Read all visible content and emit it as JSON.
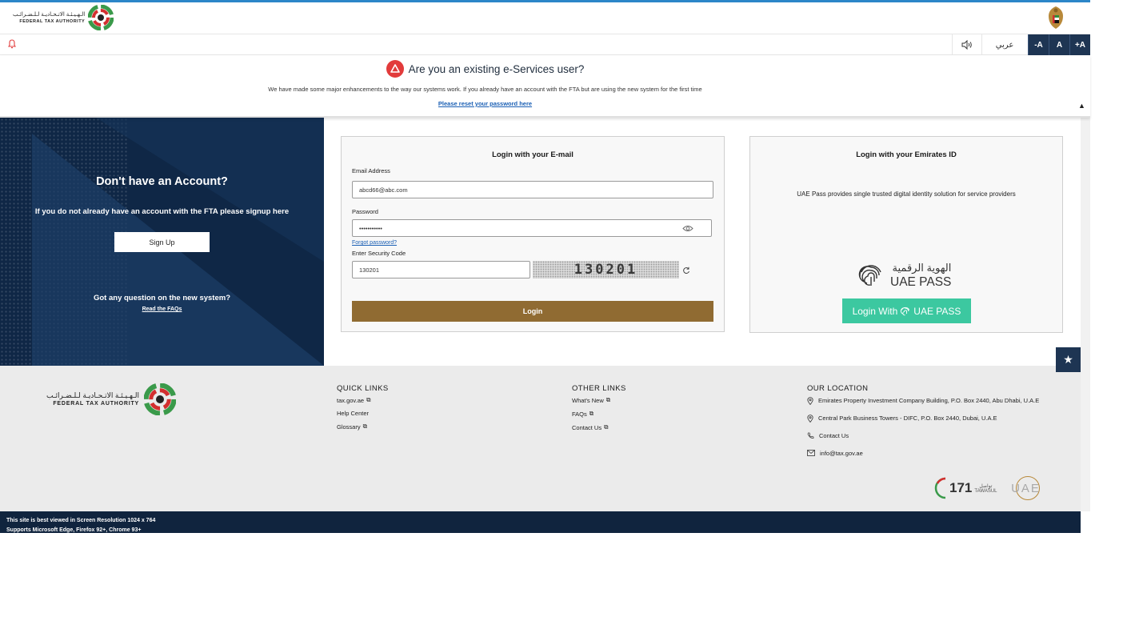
{
  "header": {
    "logo_ar": "الـهـيـئـة الاتـحـاديـة لـلـضـرائـب",
    "logo_en": "FEDERAL TAX AUTHORITY",
    "language_label": "عربي",
    "font_decrease": "-A",
    "font_reset": "A",
    "font_increase": "+A"
  },
  "notice": {
    "title": "Are you an existing e-Services user?",
    "text": "We have made some major enhancements to the way our systems work. If you already have an account with the FTA but are using the new system for the first time",
    "link": "Please reset your password here"
  },
  "promo": {
    "heading": "Don't have an Account?",
    "text": "If you do not already have an account with the FTA please signup here",
    "signup_label": "Sign Up",
    "question": "Got any question on the new system?",
    "faq_link": "Read the FAQs"
  },
  "email_login": {
    "title": "Login with your E-mail",
    "email_label": "Email Address",
    "email_value": "abcd66@abc.com",
    "password_label": "Password",
    "password_value": "•••••••••••",
    "forgot_link": "Forgot password?",
    "security_label": "Enter Security Code",
    "security_value": "130201",
    "captcha_text": "130201",
    "login_label": "Login"
  },
  "eid_login": {
    "title": "Login with your Emirates ID",
    "text": "UAE Pass provides single trusted digital identity solution for service providers",
    "logo_ar": "الهوية الرقمية",
    "logo_en": "UAE PASS",
    "button_prefix": "Login With",
    "button_brand": "UAE PASS"
  },
  "footer": {
    "logo_ar": "الـهـيـئـة الاتـحـاديـة لـلـضـرائـب",
    "logo_en": "FEDERAL TAX AUTHORITY",
    "quick_links": {
      "title": "QUICK LINKS",
      "items": [
        "tax.gov.ae",
        "Help Center",
        "Glossary"
      ]
    },
    "other_links": {
      "title": "OTHER LINKS",
      "items": [
        "What's New",
        "FAQs",
        "Contact Us"
      ]
    },
    "location": {
      "title": "OUR LOCATION",
      "address1": "Emirates Property Investment Company Building, P.O. Box 2440, Abu Dhabi, U.A.E",
      "address2": "Central Park Business Towers - DIFC, P.O. Box 2440, Dubai, U.A.E",
      "contact": "Contact Us",
      "email": "info@tax.gov.ae"
    },
    "tawasul_num": "171",
    "tawasul_ar": "تواصل",
    "tawasul_en": "TAWASUL",
    "uae_brand": "UAE"
  },
  "bottom": {
    "line1": "This site is best viewed in Screen Resolution 1024 x 764",
    "line2": "Supports Microsoft Edge, Firefox 92+, Chrome 93+"
  },
  "colors": {
    "navy": "#1e3553",
    "gold": "#906b32",
    "uaepass": "#3cc8a0",
    "link": "#1a5fb4",
    "alert": "#e23b3b"
  }
}
